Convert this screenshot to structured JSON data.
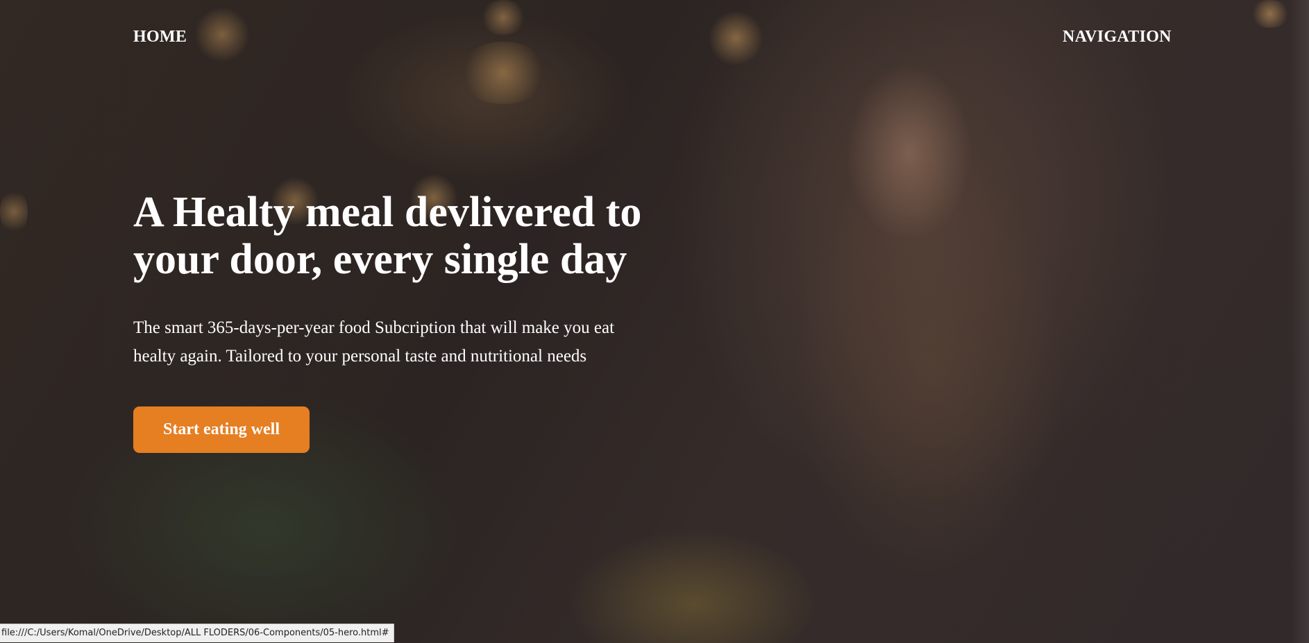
{
  "nav": {
    "home_label": "HOME",
    "navigation_label": "NAVIGATION"
  },
  "hero": {
    "heading": "A Healty meal devlivered to your door, every single day",
    "description": "The smart 365-days-per-year food Subcription that will make you eat healty again. Tailored to your personal taste and nutritional needs",
    "cta_label": "Start eating well",
    "background_image": "woman-eating-pasta-in-cafe-photo"
  },
  "status_bar": {
    "url": "file:///C:/Users/Komal/OneDrive/Desktop/ALL FLODERS/06-Components/05-hero.html#"
  },
  "colors": {
    "accent": "#e67e22",
    "text": "#ffffff"
  }
}
